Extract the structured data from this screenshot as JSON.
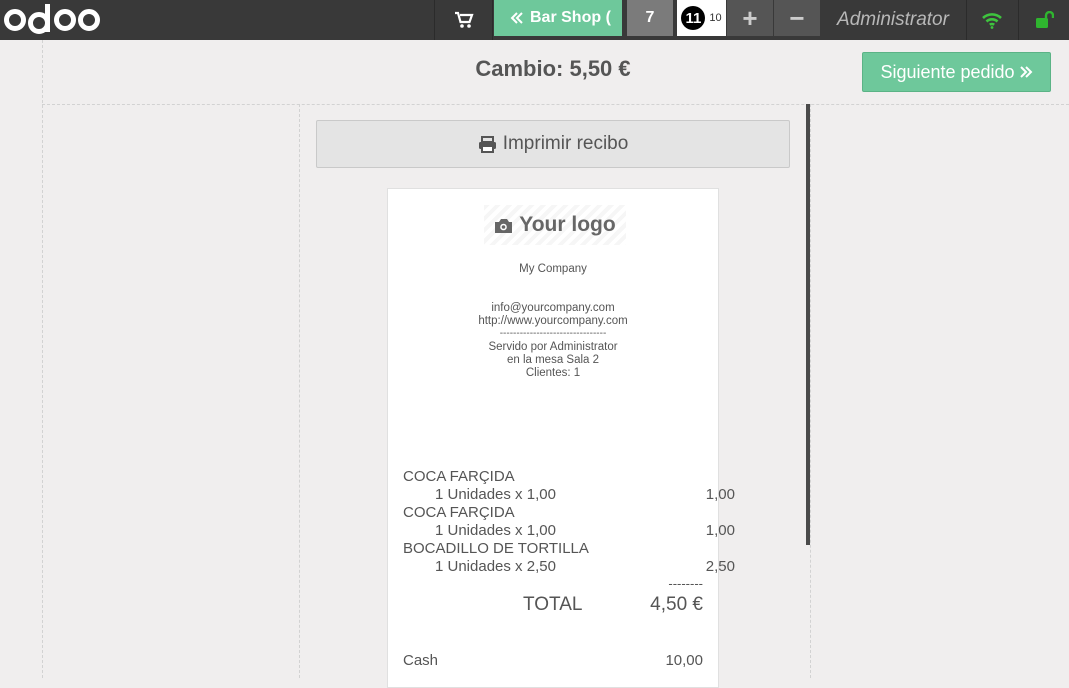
{
  "topbar": {
    "logo_text": "odoo",
    "cart_icon": "shopping-cart-icon",
    "order_button": "Bar Shop (",
    "order_icon": "double-chevron-left-icon",
    "tickets": [
      {
        "label": "7"
      },
      {
        "label": "11",
        "sub": "10"
      }
    ],
    "add_label": "+",
    "remove_label": "−",
    "user": "Administrator",
    "wifi_icon": "wifi-icon",
    "lock_icon": "unlock-icon",
    "accent_color": "#6ec89b"
  },
  "main": {
    "change_text": "Cambio: 5,50 €",
    "next_button": "Siguiente pedido",
    "next_icon": "double-chevron-right-icon",
    "print_button": "Imprimir recibo",
    "print_icon": "printer-icon"
  },
  "receipt": {
    "logo_text": "Your logo",
    "logo_icon": "camera-icon",
    "company": "My Company",
    "email": "info@yourcompany.com",
    "website": "http://www.yourcompany.com",
    "separator": "--------------------------------",
    "served_by": "Servido por Administrator",
    "table": "en la mesa Sala 2",
    "guests": "Clientes: 1",
    "lines": [
      {
        "product": "COCA FARÇIDA",
        "qty": "1 Unidades x 1,00",
        "amount": "1,00"
      },
      {
        "product": "COCA FARÇIDA",
        "qty": "1 Unidades x 1,00",
        "amount": "1,00"
      },
      {
        "product": "BOCADILLO DE TORTILLA",
        "qty": "1 Unidades x 2,50",
        "amount": "2,50"
      }
    ],
    "total_separator": "--------",
    "total_label": "TOTAL",
    "total_value": "4,50 €",
    "payment_label": "Cash",
    "payment_value": "10,00"
  }
}
